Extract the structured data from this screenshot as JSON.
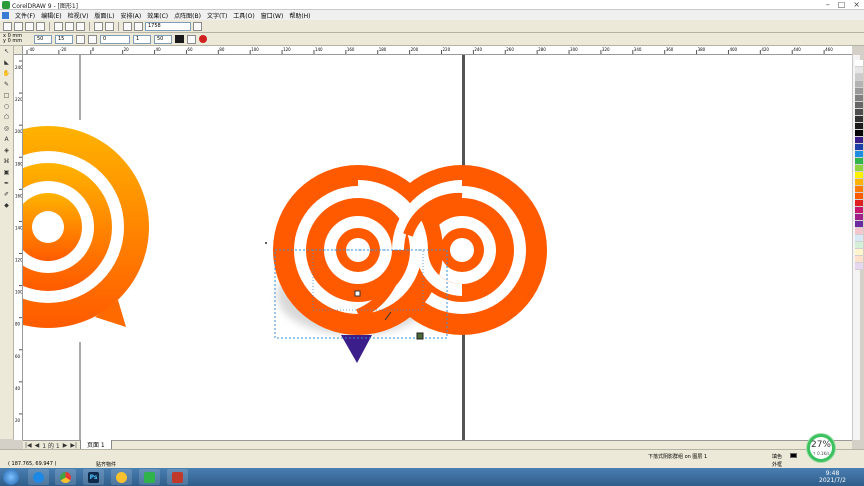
{
  "window": {
    "title": "CorelDRAW 9 - [图形1]",
    "controls": [
      "–",
      "□",
      "×"
    ]
  },
  "menu": [
    "文件(F)",
    "编辑(E)",
    "检视(V)",
    "版面(L)",
    "安排(A)",
    "效果(C)",
    "点阵图(B)",
    "文字(T)",
    "工具(O)",
    "窗口(W)",
    "帮助(H)"
  ],
  "toolbar": {
    "zoom_value": "1758",
    "outline_value": "0"
  },
  "propbar": {
    "x_label": "x",
    "x_value": "0 mm",
    "y_label": "y",
    "y_value": "0 mm",
    "width_value": "50",
    "height_value": "15",
    "angle_value": "0",
    "step_value": "1",
    "step2_value": "50"
  },
  "hruler": {
    "ticks": [
      "-40",
      "-20",
      "0",
      "20",
      "40",
      "60",
      "80",
      "100",
      "120",
      "140",
      "160",
      "180",
      "200",
      "220",
      "240",
      "260",
      "280",
      "300",
      "320",
      "340",
      "360",
      "380",
      "400",
      "420",
      "440",
      "460"
    ]
  },
  "vruler": {
    "ticks": [
      "240",
      "220",
      "200",
      "180",
      "160",
      "140",
      "120",
      "100",
      "80",
      "60",
      "40",
      "20"
    ]
  },
  "pagebar": {
    "first": "|◀",
    "prev": "◀",
    "page_index": "1 的 1",
    "next": "▶",
    "last": "▶|",
    "tab_label": "页面 1"
  },
  "status": {
    "coordinates": "( 187.765, 69.947 )",
    "tool_name": "贴齐物件",
    "layer_info": "下落式阴影群组 on 图层 1",
    "fill_label": "填色",
    "outline_label": "外框"
  },
  "network_widget": {
    "percent": "27%",
    "speed": "↑ 0.1K/s"
  },
  "taskbar": {
    "time": "9:48",
    "date": "2021/7/2",
    "apps": [
      "ie-icon",
      "chrome-icon",
      "ps-icon",
      "corel-icon",
      "app-green-icon",
      "app-red-icon"
    ],
    "ps_label": "Ps"
  },
  "colors": {
    "accent_orange": "#ff5a00",
    "logo_gradient_top": "#ffb300",
    "logo_gradient_bottom": "#ff5a00",
    "pointer_purple": "#3b1e8a",
    "palette": [
      "#ffffff",
      "#e6e6e6",
      "#cccccc",
      "#b3b3b3",
      "#999999",
      "#808080",
      "#666666",
      "#4d4d4d",
      "#333333",
      "#1a1a1a",
      "#000000",
      "#3b1e8a",
      "#1f3ea8",
      "#1c8de0",
      "#2fb34a",
      "#8fd13f",
      "#fff200",
      "#ffb300",
      "#ff7a00",
      "#ff5a00",
      "#e02020",
      "#c8186e",
      "#a0208a",
      "#6a2aa0",
      "#f5c6d0",
      "#d9e8f5",
      "#d4f0d8",
      "#fff5cc",
      "#ffe0cc",
      "#e6d6f0"
    ]
  }
}
